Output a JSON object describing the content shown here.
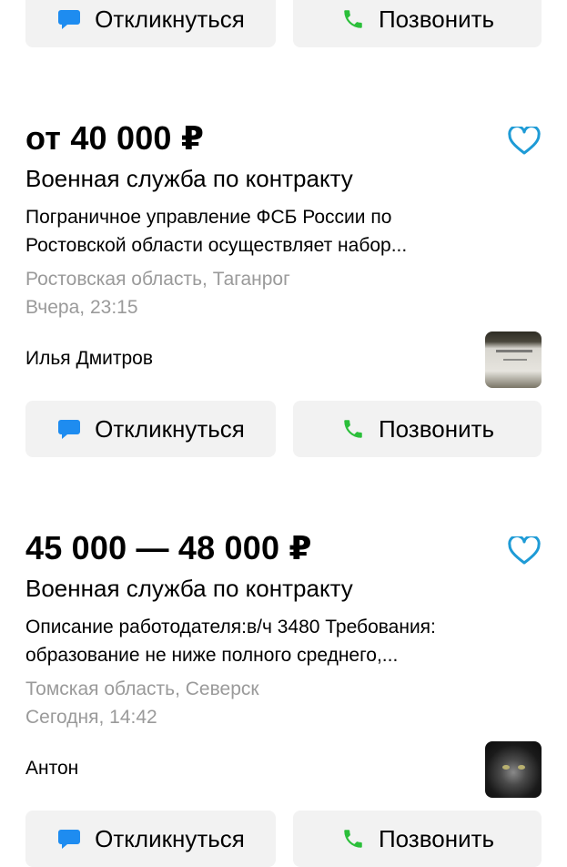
{
  "buttons": {
    "respond_label": "Откликнуться",
    "call_label": "Позвонить",
    "respond_icon": "chat-bubble-icon",
    "call_icon": "phone-icon"
  },
  "colors": {
    "chat_icon": "#1e8cf0",
    "phone_icon": "#2bbf3a",
    "heart": "#1e9bd6",
    "button_bg": "#f2f2f2",
    "muted_text": "#9a9a9a"
  },
  "listings": [
    {
      "price": "от 40 000 ₽",
      "title": "Военная служба по контракту",
      "description_line1": "Пограничное управление ФСБ России по",
      "description_line2": "Ростовской области осуществляет набор...",
      "location": "Ростовская область, Таганрог",
      "date": "Вчера, 23:15",
      "author": "Илья Дмитров",
      "favorite_icon": "heart-outline-icon"
    },
    {
      "price": "45 000 — 48 000 ₽",
      "title": "Военная служба по контракту",
      "description_line1": "Описание работодателя:в/ч 3480 Требования:",
      "description_line2": "образование не ниже полного среднего,...",
      "location": "Томская область, Северск",
      "date": "Сегодня, 14:42",
      "author": "Антон",
      "favorite_icon": "heart-outline-icon"
    }
  ]
}
